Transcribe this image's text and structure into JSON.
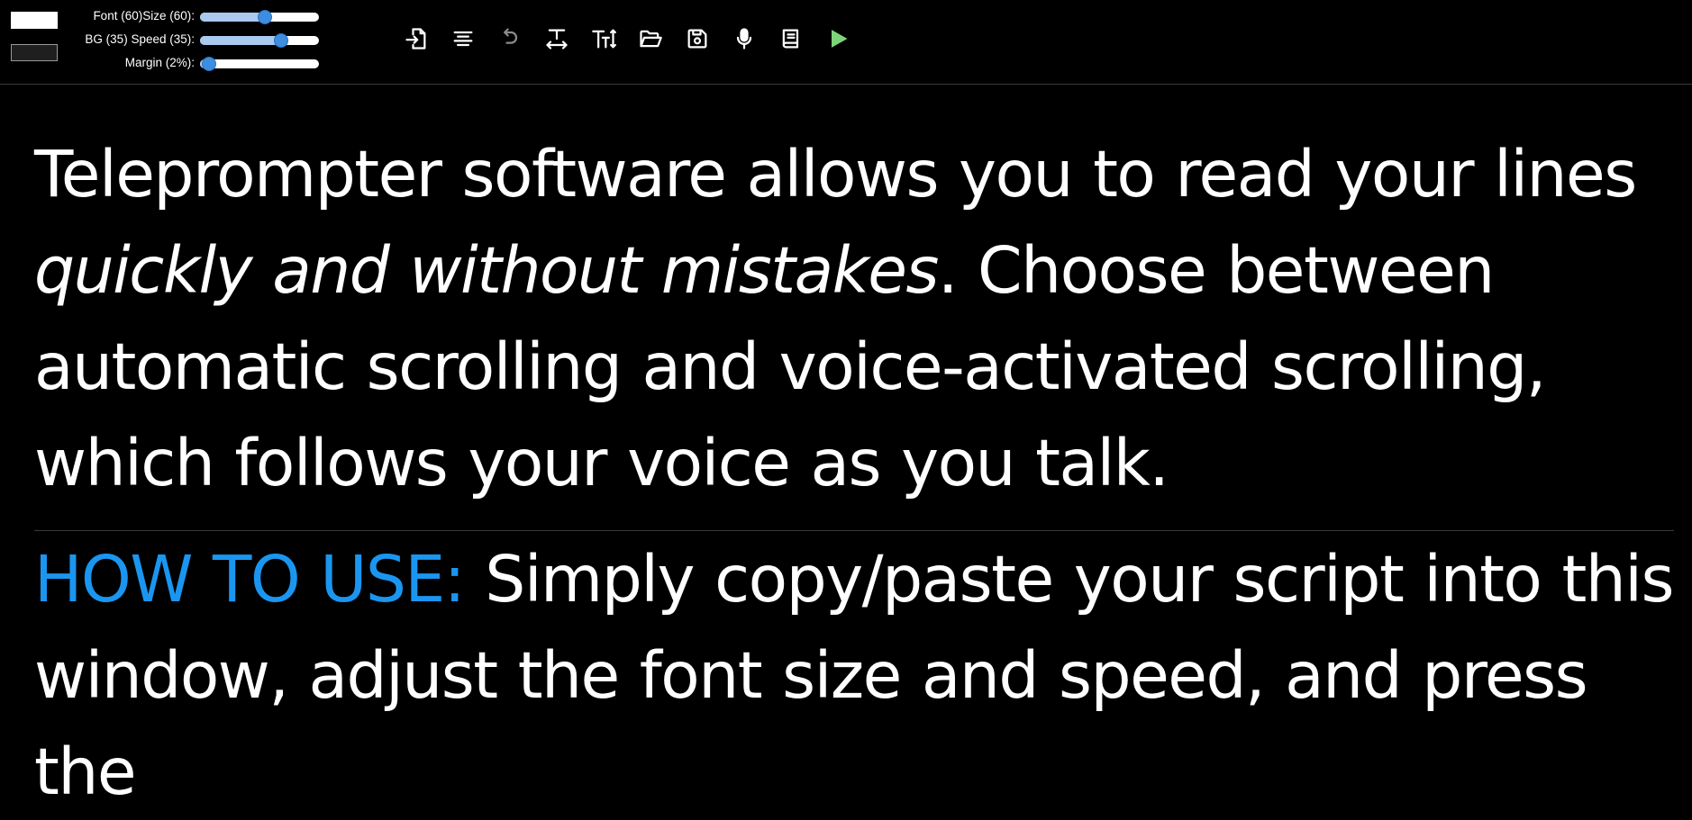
{
  "controls": {
    "font_label": "Font (60)",
    "size_label": "Size (60):",
    "bg_label": "BG (35)",
    "speed_label": "Speed (35):",
    "margin_label": "Margin (2%):",
    "size_value": 0.55,
    "speed_value": 0.71,
    "margin_value": 0.02,
    "font_color": "#ffffff",
    "bg_color": "#1f1f1f",
    "slider_accent": "#3d8ee2"
  },
  "toolbar": {
    "icons": [
      "import-icon",
      "align-center-icon",
      "undo-icon",
      "text-width-icon",
      "text-height-icon",
      "folder-open-icon",
      "save-icon",
      "microphone-icon",
      "book-icon",
      "play-icon"
    ]
  },
  "script": {
    "p1_a": "Teleprompter software allows you to read your lines ",
    "p1_em": "quickly and without mistakes",
    "p1_b": ". Choose between automatic scrolling and voice-activated scrolling, which follows your voice as you talk.",
    "howto_label": "HOW TO USE:",
    "howto_text": " Simply copy/paste your script into this window, adjust the font size and speed, and press the",
    "howto_color": "#1a96f0"
  }
}
